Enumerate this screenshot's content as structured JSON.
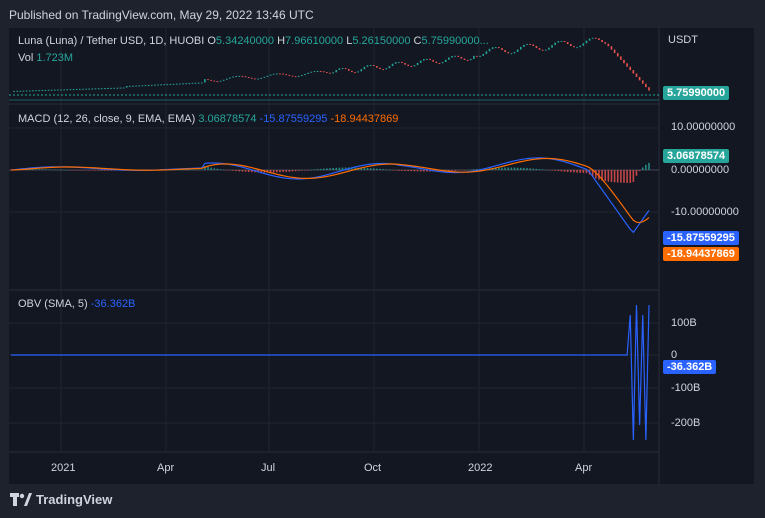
{
  "header": {
    "published": "Published on TradingView.com, May 29, 2022 13:46 UTC"
  },
  "price_pane": {
    "symbol": "Luna  (Luna)  / Tether USD, 1D, HUOBI",
    "o_label": "O",
    "o": "5.34240000",
    "h_label": "H",
    "h": "7.96610000",
    "l_label": "L",
    "l": "5.26150000",
    "c_label": "C",
    "c": "5.75990000...",
    "vol_label": "Vol",
    "vol": "1.723M",
    "currency": "USDT",
    "last_price": "5.75990000"
  },
  "macd_pane": {
    "title": "MACD (12, 26, close, 9, EMA, EMA)",
    "hist": "3.06878574",
    "macd": "-15.87559295",
    "signal": "-18.94437869",
    "axis": [
      "10.00000000",
      "0.00000000",
      "-10.00000000"
    ]
  },
  "obv_pane": {
    "title": "OBV (SMA, 5)",
    "value": "-36.362B",
    "axis": [
      "100B",
      "0",
      "-100B",
      "-200B"
    ]
  },
  "time_axis": [
    "2021",
    "Apr",
    "Jul",
    "Oct",
    "2022",
    "Apr"
  ],
  "footer": {
    "brand": "TradingView"
  },
  "colors": {
    "bg": "#131722",
    "up": "#26a69a",
    "down": "#ef5350",
    "macd": "#2962ff",
    "signal": "#ff6d00"
  }
}
